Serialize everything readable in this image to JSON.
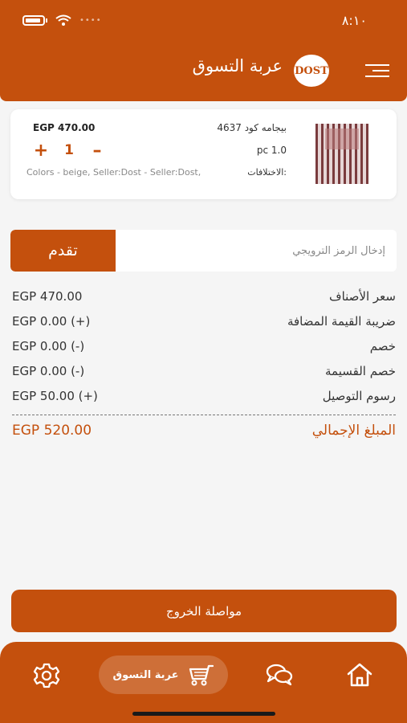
{
  "status_bar": {
    "time": "٨:١٠"
  },
  "header": {
    "title": "عربة التسوق",
    "logo_text": "DOST"
  },
  "cart_item": {
    "name": "بيجامه كود 4637",
    "price": "EGP 470.00",
    "quantity": "1",
    "qty_unit": "pc 1.0",
    "variations_label": "الاختلافات:",
    "variations_value": "Colors - beige,  Seller:Dost - Seller:Dost,"
  },
  "promo": {
    "placeholder": "إدخال الرمز الترويجي",
    "button_label": "تقدم"
  },
  "summary": {
    "rows": [
      {
        "label": "سعر الأصناف",
        "value": "EGP 470.00"
      },
      {
        "label": "ضريبة القيمة المضافة",
        "value": "EGP 0.00 (+)"
      },
      {
        "label": "خصم",
        "value": "EGP 0.00 (-)"
      },
      {
        "label": "خصم القسيمة",
        "value": "EGP 0.00 (-)"
      },
      {
        "label": "رسوم التوصيل",
        "value": "EGP 50.00 (+)"
      }
    ],
    "total_label": "المبلغ الإجمالي",
    "total_value": "EGP 520.00"
  },
  "checkout_label": "مواصلة الخروج",
  "bottom_nav": {
    "cart_label": "عربة التسوق"
  },
  "colors": {
    "accent": "#c4500d",
    "background": "#f5f5f5"
  }
}
